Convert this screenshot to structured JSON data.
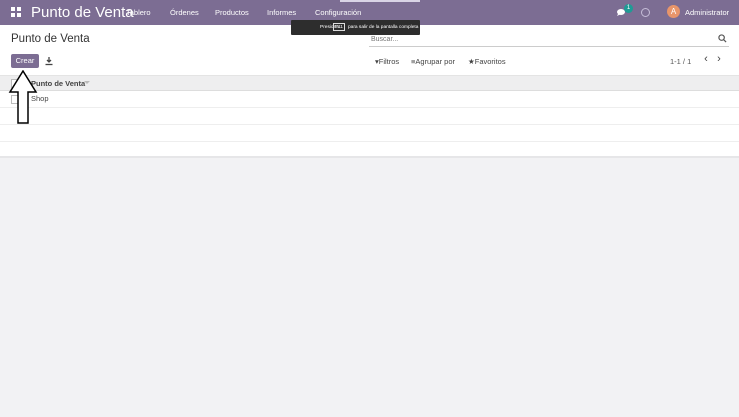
{
  "navbar": {
    "app_title": "Punto de Venta",
    "menu": [
      "Tablero",
      "Órdenes",
      "Productos",
      "Informes",
      "Configuración"
    ],
    "notification_count": "1",
    "avatar_initial": "A",
    "user_name": "Administrator"
  },
  "toast": {
    "text_before": "Presiona",
    "key": "F11",
    "text_after": "para salir de la pantalla completa"
  },
  "control_panel": {
    "breadcrumb": "Punto de Venta",
    "search_placeholder": "Buscar...",
    "create_label": "Crear",
    "filters_label": "Filtros",
    "group_by_label": "Agrupar por",
    "favorites_label": "Favoritos",
    "pager": "1-1 / 1"
  },
  "list": {
    "columns": [
      "Punto de Venta"
    ],
    "rows": [
      {
        "name": "Shop"
      }
    ]
  },
  "colors": {
    "brand": "#7c6d93",
    "badge": "#1f9b95",
    "avatar": "#e8956a"
  },
  "icons": [
    "apps-icon",
    "chat-icon",
    "clock-icon",
    "download-icon",
    "search-icon",
    "filter-icon",
    "group-by-icon",
    "star-icon",
    "chevron-left-icon",
    "chevron-right-icon",
    "arrow-up-icon"
  ]
}
